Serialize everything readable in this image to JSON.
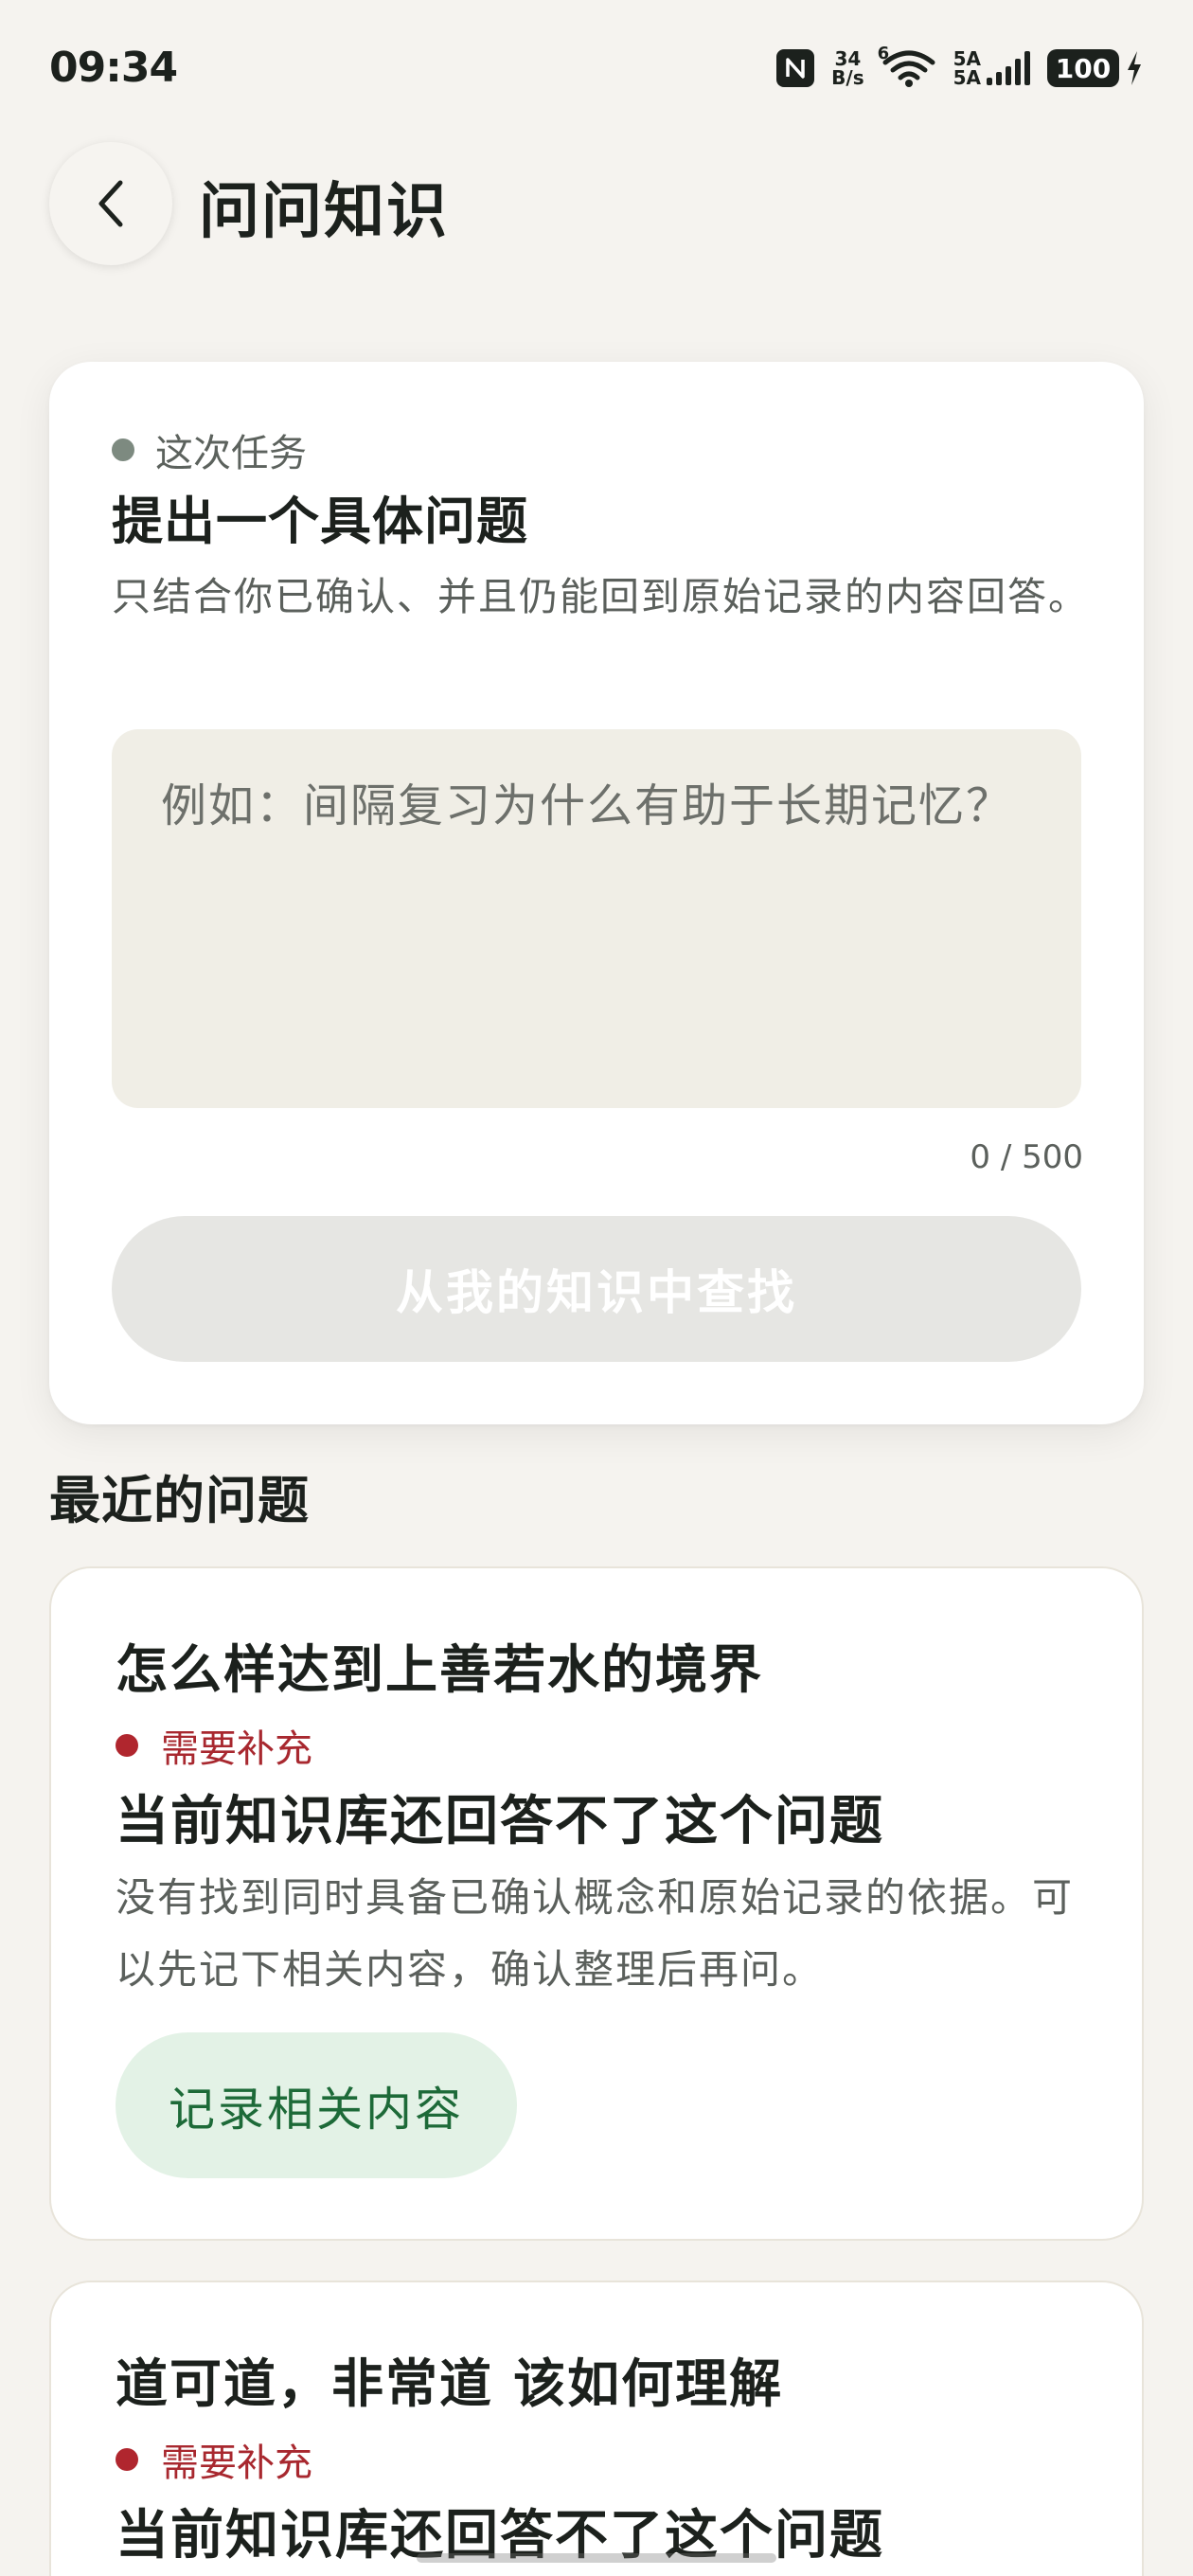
{
  "status_bar": {
    "time": "09:34",
    "net_speed_value": "34",
    "net_speed_unit": "B/s",
    "sim1_label": "5A",
    "sim2_label": "5A",
    "wifi_label": "6",
    "battery_level": "100"
  },
  "header": {
    "title": "问问知识"
  },
  "ask_card": {
    "tag": "这次任务",
    "title": "提出一个具体问题",
    "description": "只结合你已确认、并且仍能回到原始记录的内容回答。",
    "input_placeholder": "例如：间隔复习为什么有助于长期记忆？",
    "input_value": "",
    "char_count": "0 / 500",
    "submit_label": "从我的知识中查找"
  },
  "recent": {
    "section_title": "最近的问题",
    "items": [
      {
        "question": "怎么样达到上善若水的境界",
        "status": "需要补充",
        "status_title": "当前知识库还回答不了这个问题",
        "status_desc": "没有找到同时具备已确认概念和原始记录的依据。可以先记下相关内容，确认整理后再问。",
        "action_label": "记录相关内容"
      },
      {
        "question": "道可道，非常道 该如何理解",
        "status": "需要补充",
        "status_title": "当前知识库还回答不了这个问题"
      }
    ]
  },
  "colors": {
    "accent_green": "#1d6a38",
    "status_red": "#a8282f",
    "background": "#f5f3ef"
  }
}
